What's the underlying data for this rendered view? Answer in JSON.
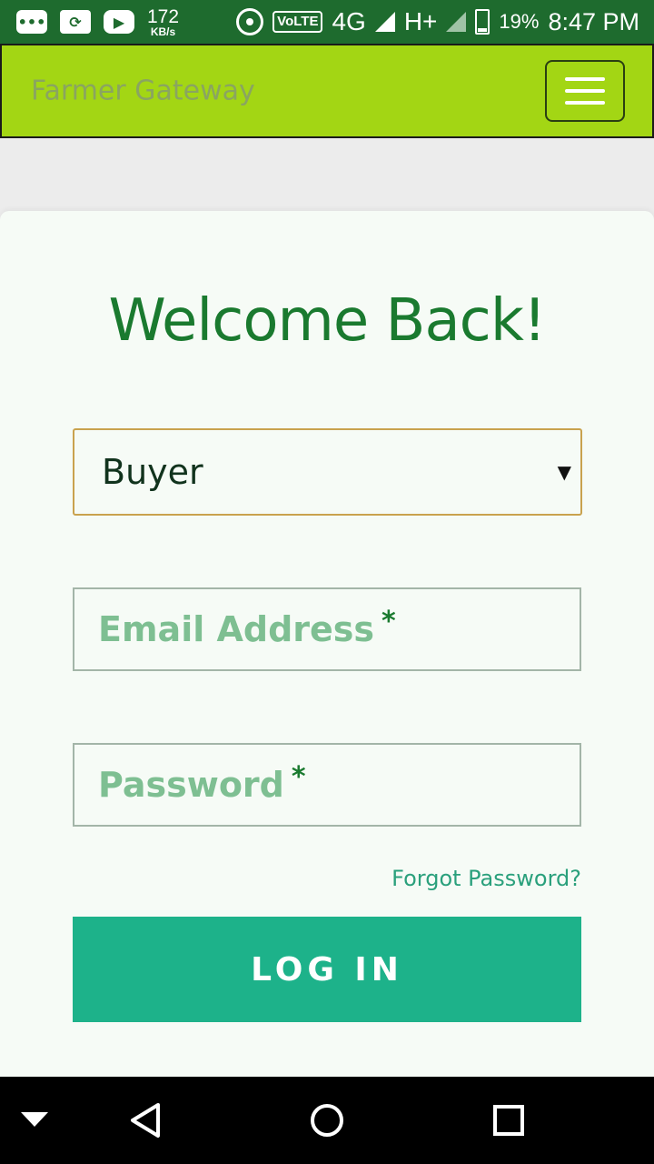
{
  "status_bar": {
    "speed_value": "172",
    "speed_unit": "KB/s",
    "volte": "VoLTE",
    "network_4g": "4G",
    "network_h": "H+",
    "battery_percent": "19%",
    "time": "8:47 PM",
    "icons": [
      "message-icon",
      "sync-icon",
      "youtube-icon",
      "hotspot-icon",
      "signal-icon",
      "battery-icon"
    ]
  },
  "app_bar": {
    "brand": "Farmer Gateway",
    "menu_icon": "hamburger-menu-icon",
    "color": "#a3d614"
  },
  "login": {
    "title": "Welcome Back!",
    "role_select": {
      "selected": "Buyer"
    },
    "email_placeholder": "Email Address",
    "password_placeholder": "Password",
    "required_marker": "*",
    "forgot_password": "Forgot Password?",
    "submit_label": "LOG IN",
    "accent_color": "#1db28a"
  },
  "nav_bar": {
    "icons": [
      "notification-drawer-icon",
      "back-icon",
      "home-icon",
      "recents-icon"
    ]
  }
}
